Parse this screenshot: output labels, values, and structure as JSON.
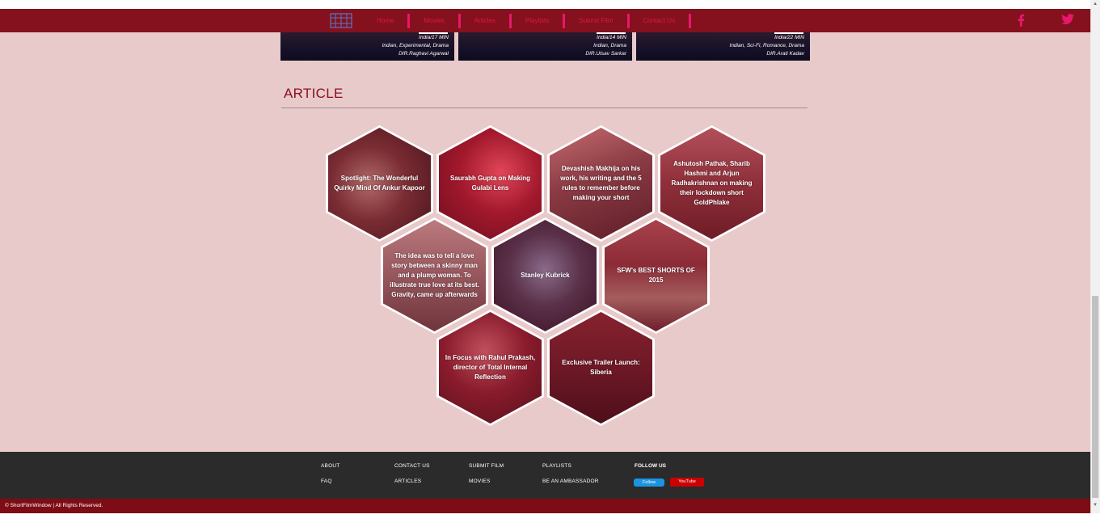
{
  "nav": {
    "items": [
      {
        "label": "Home"
      },
      {
        "label": "Movies"
      },
      {
        "label": "Articles"
      },
      {
        "label": "Playlists"
      },
      {
        "label": "Submit Film"
      },
      {
        "label": "Contact Us"
      }
    ],
    "social": {
      "facebook_icon": "f",
      "twitter_icon": "twitter-bird"
    }
  },
  "movies": [
    {
      "meta1": "India/17 MIN",
      "meta2": "Indian, Experimental, Drama",
      "meta3": "DIR.Raghavi Agarwal"
    },
    {
      "meta1": "India/14 MIN",
      "meta2": "Indian, Drama",
      "meta3": "DIR.Utsav Sarkar"
    },
    {
      "meta1": "India/22 MIN",
      "meta2": "Indian, Sci-Fi, Romance, Drama",
      "meta3": "DIR.Arati Kadav"
    }
  ],
  "articles": {
    "title": "ARTICLE",
    "items": [
      {
        "label": "Spotlight: The Wonderful Quirky Mind Of Ankur Kapoor"
      },
      {
        "label": "Saurabh Gupta on Making Gulabi Lens"
      },
      {
        "label": "Devashish Makhija on his work, his writing and the 5 rules to remember before making your short"
      },
      {
        "label": "Ashutosh Pathak, Sharib Hashmi and Arjun Radhakrishnan on making their lockdown short GoldPhlake"
      },
      {
        "label": "The idea was to tell a love story between a skinny man and a plump woman. To illustrate true love at its best. Gravity, came up afterwards"
      },
      {
        "label": "Stanley Kubrick"
      },
      {
        "label": "SFW's BEST SHORTS OF 2015"
      },
      {
        "label": "In Focus with Rahul Prakash, director of Total Internal Reflection"
      },
      {
        "label": "Exclusive Trailer Launch: Siberia"
      }
    ]
  },
  "footer": {
    "links": {
      "about": "ABOUT",
      "faq": "FAQ",
      "contact_us": "CONTACT US",
      "articles": "ARTICLES",
      "submit_film": "SUBMIT FILM",
      "movies": "MOVIES",
      "playlists": "PLAYLISTS",
      "ambassador": "BE AN AMBASSADOR"
    },
    "follow_title": "FOLLOW US",
    "twitter_follow": "Follow",
    "youtube": "YouTube",
    "copyright": "© ShortFilmWindow | All Rights Reserved."
  },
  "colors": {
    "navbar": "#84111d",
    "nav_text": "#e0163f",
    "page_bg": "#e8cacb",
    "heading": "#8c0f1c",
    "footer": "#2b2b2b",
    "copyright_bar": "#7d0c14"
  }
}
